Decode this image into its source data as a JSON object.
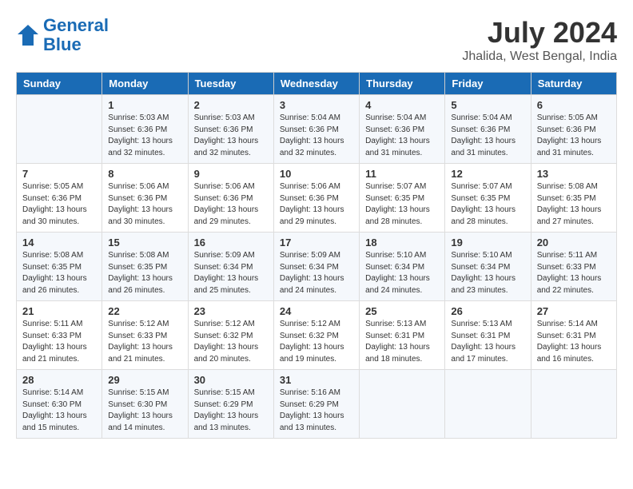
{
  "logo": {
    "line1": "General",
    "line2": "Blue"
  },
  "title": "July 2024",
  "location": "Jhalida, West Bengal, India",
  "days_of_week": [
    "Sunday",
    "Monday",
    "Tuesday",
    "Wednesday",
    "Thursday",
    "Friday",
    "Saturday"
  ],
  "weeks": [
    [
      {
        "day": "",
        "info": ""
      },
      {
        "day": "1",
        "info": "Sunrise: 5:03 AM\nSunset: 6:36 PM\nDaylight: 13 hours\nand 32 minutes."
      },
      {
        "day": "2",
        "info": "Sunrise: 5:03 AM\nSunset: 6:36 PM\nDaylight: 13 hours\nand 32 minutes."
      },
      {
        "day": "3",
        "info": "Sunrise: 5:04 AM\nSunset: 6:36 PM\nDaylight: 13 hours\nand 32 minutes."
      },
      {
        "day": "4",
        "info": "Sunrise: 5:04 AM\nSunset: 6:36 PM\nDaylight: 13 hours\nand 31 minutes."
      },
      {
        "day": "5",
        "info": "Sunrise: 5:04 AM\nSunset: 6:36 PM\nDaylight: 13 hours\nand 31 minutes."
      },
      {
        "day": "6",
        "info": "Sunrise: 5:05 AM\nSunset: 6:36 PM\nDaylight: 13 hours\nand 31 minutes."
      }
    ],
    [
      {
        "day": "7",
        "info": "Sunrise: 5:05 AM\nSunset: 6:36 PM\nDaylight: 13 hours\nand 30 minutes."
      },
      {
        "day": "8",
        "info": "Sunrise: 5:06 AM\nSunset: 6:36 PM\nDaylight: 13 hours\nand 30 minutes."
      },
      {
        "day": "9",
        "info": "Sunrise: 5:06 AM\nSunset: 6:36 PM\nDaylight: 13 hours\nand 29 minutes."
      },
      {
        "day": "10",
        "info": "Sunrise: 5:06 AM\nSunset: 6:36 PM\nDaylight: 13 hours\nand 29 minutes."
      },
      {
        "day": "11",
        "info": "Sunrise: 5:07 AM\nSunset: 6:35 PM\nDaylight: 13 hours\nand 28 minutes."
      },
      {
        "day": "12",
        "info": "Sunrise: 5:07 AM\nSunset: 6:35 PM\nDaylight: 13 hours\nand 28 minutes."
      },
      {
        "day": "13",
        "info": "Sunrise: 5:08 AM\nSunset: 6:35 PM\nDaylight: 13 hours\nand 27 minutes."
      }
    ],
    [
      {
        "day": "14",
        "info": "Sunrise: 5:08 AM\nSunset: 6:35 PM\nDaylight: 13 hours\nand 26 minutes."
      },
      {
        "day": "15",
        "info": "Sunrise: 5:08 AM\nSunset: 6:35 PM\nDaylight: 13 hours\nand 26 minutes."
      },
      {
        "day": "16",
        "info": "Sunrise: 5:09 AM\nSunset: 6:34 PM\nDaylight: 13 hours\nand 25 minutes."
      },
      {
        "day": "17",
        "info": "Sunrise: 5:09 AM\nSunset: 6:34 PM\nDaylight: 13 hours\nand 24 minutes."
      },
      {
        "day": "18",
        "info": "Sunrise: 5:10 AM\nSunset: 6:34 PM\nDaylight: 13 hours\nand 24 minutes."
      },
      {
        "day": "19",
        "info": "Sunrise: 5:10 AM\nSunset: 6:34 PM\nDaylight: 13 hours\nand 23 minutes."
      },
      {
        "day": "20",
        "info": "Sunrise: 5:11 AM\nSunset: 6:33 PM\nDaylight: 13 hours\nand 22 minutes."
      }
    ],
    [
      {
        "day": "21",
        "info": "Sunrise: 5:11 AM\nSunset: 6:33 PM\nDaylight: 13 hours\nand 21 minutes."
      },
      {
        "day": "22",
        "info": "Sunrise: 5:12 AM\nSunset: 6:33 PM\nDaylight: 13 hours\nand 21 minutes."
      },
      {
        "day": "23",
        "info": "Sunrise: 5:12 AM\nSunset: 6:32 PM\nDaylight: 13 hours\nand 20 minutes."
      },
      {
        "day": "24",
        "info": "Sunrise: 5:12 AM\nSunset: 6:32 PM\nDaylight: 13 hours\nand 19 minutes."
      },
      {
        "day": "25",
        "info": "Sunrise: 5:13 AM\nSunset: 6:31 PM\nDaylight: 13 hours\nand 18 minutes."
      },
      {
        "day": "26",
        "info": "Sunrise: 5:13 AM\nSunset: 6:31 PM\nDaylight: 13 hours\nand 17 minutes."
      },
      {
        "day": "27",
        "info": "Sunrise: 5:14 AM\nSunset: 6:31 PM\nDaylight: 13 hours\nand 16 minutes."
      }
    ],
    [
      {
        "day": "28",
        "info": "Sunrise: 5:14 AM\nSunset: 6:30 PM\nDaylight: 13 hours\nand 15 minutes."
      },
      {
        "day": "29",
        "info": "Sunrise: 5:15 AM\nSunset: 6:30 PM\nDaylight: 13 hours\nand 14 minutes."
      },
      {
        "day": "30",
        "info": "Sunrise: 5:15 AM\nSunset: 6:29 PM\nDaylight: 13 hours\nand 13 minutes."
      },
      {
        "day": "31",
        "info": "Sunrise: 5:16 AM\nSunset: 6:29 PM\nDaylight: 13 hours\nand 13 minutes."
      },
      {
        "day": "",
        "info": ""
      },
      {
        "day": "",
        "info": ""
      },
      {
        "day": "",
        "info": ""
      }
    ]
  ]
}
